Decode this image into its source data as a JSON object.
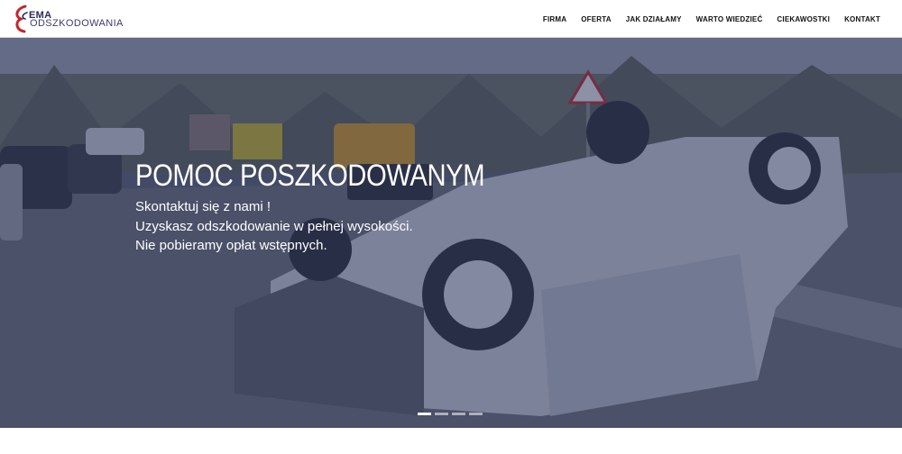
{
  "logo": {
    "line1": "EMA",
    "line2": "ODSZKODOWANIA"
  },
  "nav": [
    {
      "label": "FIRMA"
    },
    {
      "label": "OFERTA"
    },
    {
      "label": "JAK DZIAŁAMY"
    },
    {
      "label": "WARTO WIEDZIEĆ"
    },
    {
      "label": "CIEKAWOSTKI"
    },
    {
      "label": "KONTAKT"
    }
  ],
  "hero": {
    "title": "POMOC POSZKODOWANYM",
    "lines": [
      "Skontaktuj się z nami !",
      "Uzyskasz odszkodowanie w pełnej wysokości.",
      "Nie pobieramy opłat wstępnych."
    ],
    "slides": 4,
    "active_slide": 1
  },
  "colors": {
    "overlay": "#28325f",
    "logo_red": "#c0272d",
    "logo_navy": "#2b2b5a"
  }
}
